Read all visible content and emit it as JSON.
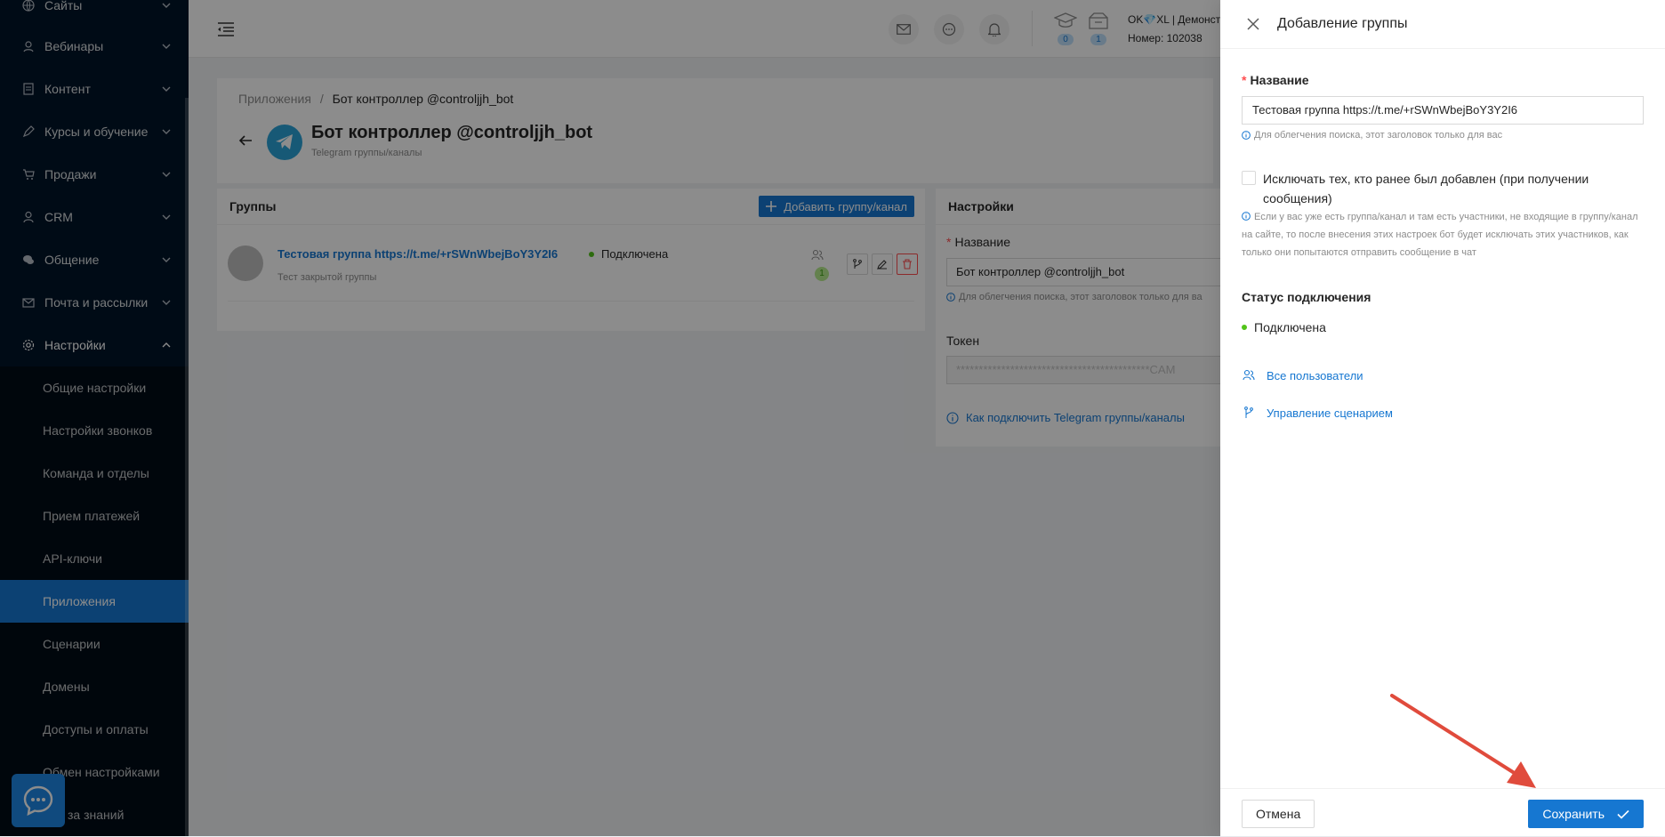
{
  "sidebar": {
    "items": [
      {
        "label": "Сайты",
        "icon": "globe-icon"
      },
      {
        "label": "Вебинары",
        "icon": "webinar-icon"
      },
      {
        "label": "Контент",
        "icon": "content-icon"
      },
      {
        "label": "Курсы и обучение",
        "icon": "courses-icon"
      },
      {
        "label": "Продажи",
        "icon": "cart-icon"
      },
      {
        "label": "CRM",
        "icon": "user-icon"
      },
      {
        "label": "Общение",
        "icon": "chat-icon"
      },
      {
        "label": "Почта и рассылки",
        "icon": "mail-icon"
      },
      {
        "label": "Настройки",
        "icon": "gear-icon"
      }
    ],
    "sub_items": [
      {
        "label": "Общие настройки"
      },
      {
        "label": "Настройки звонков"
      },
      {
        "label": "Команда и отделы"
      },
      {
        "label": "Прием платежей"
      },
      {
        "label": "API-ключи"
      },
      {
        "label": "Приложения",
        "active": true
      },
      {
        "label": "Сценарии"
      },
      {
        "label": "Домены"
      },
      {
        "label": "Доступы и оплаты"
      },
      {
        "label": "Обмен настройками"
      },
      {
        "label": "за знаний"
      }
    ]
  },
  "header": {
    "courses_badge": "0",
    "orders_badge": "1",
    "account_name": "OK💎XL | Демонст",
    "account_number": "Номер: 102038"
  },
  "page": {
    "breadcrumb_root": "Приложения",
    "breadcrumb_sep": "/",
    "breadcrumb_current": "Бот контроллер @controljjh_bot",
    "title": "Бот контроллер @controljjh_bot",
    "subtitle": "Telegram группы/каналы"
  },
  "groups": {
    "title": "Группы",
    "add_button": "Добавить группу/канал",
    "rows": [
      {
        "name": "Тестовая группа https://t.me/+rSWnWbejBoY3Y2I6",
        "status": "Подключена",
        "description": "Тест закрытой группы",
        "users_count": "1"
      }
    ]
  },
  "settings": {
    "title": "Настройки",
    "name_label": "Название",
    "name_value": "Бот контроллер @controljjh_bot",
    "name_hint": "Для облегчения поиска, этот заголовок только для ва",
    "token_label": "Токен",
    "token_value": "*******************************************CAM",
    "help_link": "Как подключить Telegram группы/каналы"
  },
  "drawer": {
    "title": "Добавление группы",
    "name_label": "Название",
    "name_value": "Тестовая группа https://t.me/+rSWnWbejBoY3Y2I6",
    "name_hint": "Для облегчения поиска, этот заголовок только для вас",
    "exclude_label": "Исключать тех, кто ранее был добавлен (при получении сообщения)",
    "exclude_hint": "Если у вас уже есть группа/канал и там есть участники, не входящие в группу/канал на сайте, то после внесения этих настроек бот будет исключать этих участников, как только они попытаются отправить сообщение в чат",
    "exclude_checked": false,
    "status_title": "Статус подключения",
    "status_value": "Подключена",
    "link_users": "Все пользователи",
    "link_scenario": "Управление сценарием",
    "cancel_button": "Отмена",
    "save_button": "Сохранить"
  },
  "colors": {
    "sidebar_bg": "#001529",
    "accent": "#1677d1",
    "success": "#52c41a",
    "danger": "#ff4d4f",
    "annotation_arrow": "#e04b3c"
  }
}
